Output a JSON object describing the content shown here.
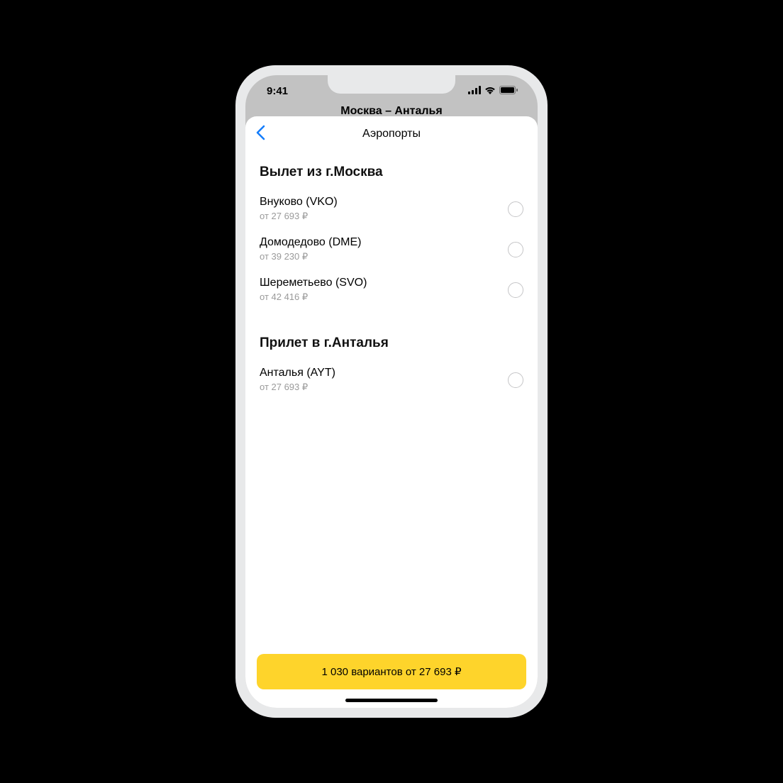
{
  "status": {
    "time": "9:41"
  },
  "behind": {
    "route": "Москва – Анталья"
  },
  "header": {
    "title": "Аэропорты"
  },
  "departure": {
    "title": "Вылет из г.Москва",
    "airports": [
      {
        "name": "Внуково (VKO)",
        "price": "от 27 693 ₽"
      },
      {
        "name": "Домодедово (DME)",
        "price": "от 39 230 ₽"
      },
      {
        "name": "Шереметьево (SVO)",
        "price": "от 42 416 ₽"
      }
    ]
  },
  "arrival": {
    "title": "Прилет в г.Анталья",
    "airports": [
      {
        "name": "Анталья (AYT)",
        "price": "от 27 693 ₽"
      }
    ]
  },
  "cta": {
    "label": "1 030 вариантов от 27 693 ₽"
  }
}
